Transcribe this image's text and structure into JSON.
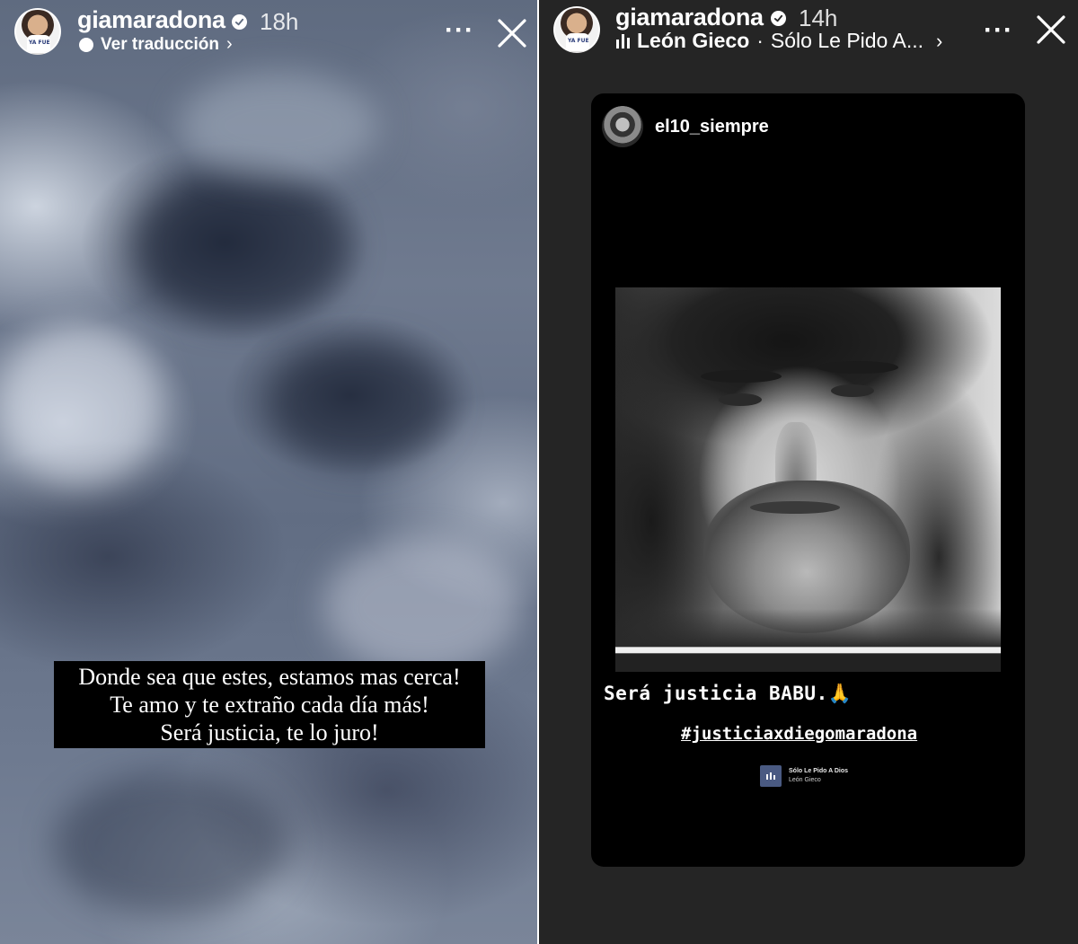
{
  "left_story": {
    "username": "giamaradona",
    "time": "18h",
    "translate_label": "Ver traducción",
    "avatar_shirt_text": "YA FUE",
    "caption_lines": [
      "Donde sea que estes, estamos mas cerca!",
      "Te amo y te extraño cada día más!",
      "Será justicia, te lo juro!"
    ]
  },
  "right_story": {
    "username": "giamaradona",
    "time": "14h",
    "music_artist": "León Gieco",
    "music_separator": "·",
    "music_song": "Sólo Le Pido A...",
    "avatar_shirt_text": "YA FUE",
    "shared_post": {
      "username": "el10_siempre",
      "caption": "Será justicia BABU.🙏",
      "hashtag": "#justiciaxdiegomaradona",
      "music_sticker": {
        "title": "Sólo Le Pido A Dios",
        "artist": "León Gieco"
      }
    }
  },
  "icons": {
    "more": "more-options-icon",
    "close": "close-icon",
    "verified": "verified-badge-icon",
    "translate": "translate-icon",
    "chevron": "chevron-right-icon",
    "music": "music-bars-icon"
  },
  "colors": {
    "story_text": "#ffffff",
    "right_background": "#252525",
    "card_background": "#000000",
    "caption_box": "#000000"
  }
}
